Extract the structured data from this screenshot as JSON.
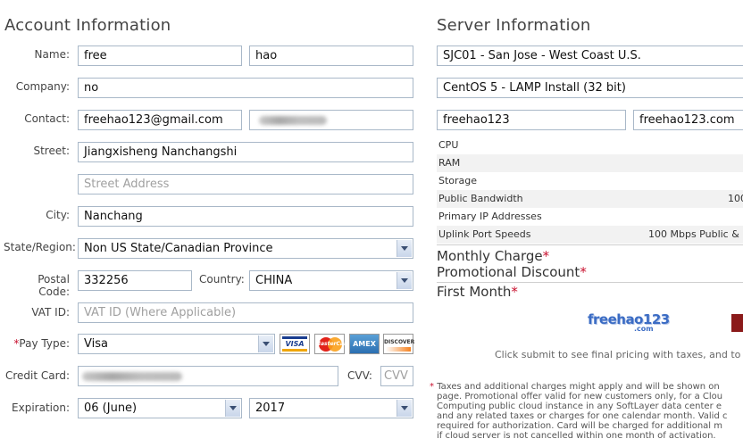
{
  "account": {
    "title": "Account Information",
    "labels": {
      "name": "Name:",
      "company": "Company:",
      "contact": "Contact:",
      "street": "Street:",
      "city": "City:",
      "state": "State/Region:",
      "postal": "Postal Code:",
      "country": "Country:",
      "vat": "VAT ID:",
      "pay_type": "Pay Type:",
      "credit_card": "Credit Card:",
      "cvv": "CVV:",
      "expiration": "Expiration:"
    },
    "first_name": "free",
    "last_name": "hao",
    "company": "no",
    "email": "freehao123@gmail.com",
    "street1": "Jiangxisheng Nanchangshi",
    "street2_placeholder": "Street Address",
    "city": "Nanchang",
    "state": "Non US State/Canadian Province",
    "postal": "332256",
    "country": "CHINA",
    "vat_placeholder": "VAT ID (Where Applicable)",
    "pay_type": "Visa",
    "cvv_placeholder": "CVV",
    "exp_month": "06 (June)",
    "exp_year": "2017",
    "cards": [
      "VISA",
      "MasterCard",
      "AMEX",
      "DISCOVER"
    ]
  },
  "server": {
    "title": "Server Information",
    "datacenter": "SJC01 - San Jose - West Coast U.S.",
    "os": "CentOS 5 - LAMP Install (32 bit)",
    "hostname": "freehao123",
    "domain": "freehao123.com",
    "specs": [
      {
        "label": "CPU",
        "value": ""
      },
      {
        "label": "RAM",
        "value": ""
      },
      {
        "label": "Storage",
        "value": ""
      },
      {
        "label": "Public Bandwidth",
        "value": "100"
      },
      {
        "label": "Primary IP Addresses",
        "value": ""
      },
      {
        "label": "Uplink Port Speeds",
        "value": "100 Mbps Public &"
      }
    ],
    "monthly_charge": "Monthly Charge",
    "promo_discount": "Promotional Discount",
    "first_month": "First Month",
    "req_mark": "*",
    "logo_text": "freehao123",
    "logo_sub": ".com",
    "submit_note": "Click submit to see final pricing with taxes, and to re",
    "disclaimer": [
      "Taxes and additional charges might apply and will be shown on",
      "page. Promotional offer valid for new customers only, for a Clou",
      "Computing public cloud instance in any SoftLayer data center e",
      "and any related taxes or charges for one calendar month. Valid c",
      "required for authorization. Card will be charged for additional m",
      "if cloud server is not cancelled within one month of activation."
    ]
  }
}
